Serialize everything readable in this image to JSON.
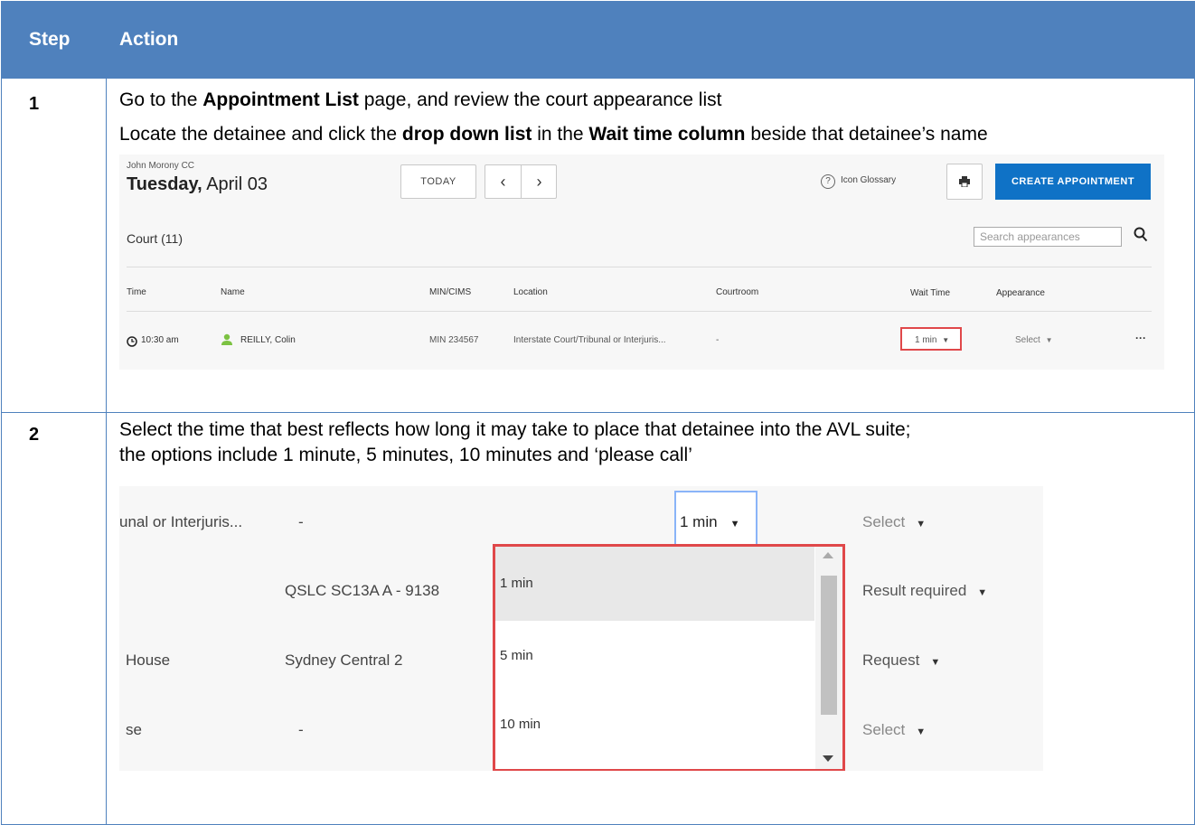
{
  "table": {
    "header_step": "Step",
    "header_action": "Action"
  },
  "step1": {
    "number": "1",
    "line1_pre": "Go to the ",
    "line1_bold": "Appointment List",
    "line1_post": " page, and review the court appearance list",
    "line2_pre": "Locate the detainee and click the ",
    "line2_bold1": "drop down list",
    "line2_mid": " in the ",
    "line2_bold2": "Wait time column",
    "line2_post": " beside that detainee’s name"
  },
  "screenshot1": {
    "centre": "John Morony CC",
    "day": "Tuesday,",
    "date": "April 03",
    "today_button": "TODAY",
    "prev": "‹",
    "next": "›",
    "glossary_icon": "?",
    "glossary": "Icon Glossary",
    "print_icon": "print-icon",
    "create_button": "CREATE APPOINTMENT",
    "court_heading": "Court (11)",
    "search_placeholder": "Search appearances",
    "columns": [
      "Time",
      "Name",
      "MIN/CIMS",
      "Location",
      "Courtroom",
      "Wait Time",
      "Appearance"
    ],
    "row": {
      "time": "10:30 am",
      "name": "REILLY, Colin",
      "min": "MIN 234567",
      "location": "Interstate Court/Tribunal or Interjuris...",
      "courtroom": "-",
      "wait": "1 min",
      "appearance": "Select",
      "more": "···"
    },
    "colors": {
      "accent": "#0f72c6",
      "highlight": "#e0484a",
      "person": "#7cc242"
    }
  },
  "step2": {
    "number": "2",
    "line1": "Select the time that best reflects how long it may take to place that detainee into the AVL suite;",
    "line2": "the options include 1 minute, 5 minutes, 10 minutes and ‘please call’"
  },
  "screenshot2": {
    "row1": {
      "location": "unal or Interjuris...",
      "courtroom": "-",
      "wait": "1 min",
      "appearance": "Select"
    },
    "row2": {
      "courtroom": "QSLC SC13A A - 9138",
      "appearance": "Result required"
    },
    "row3": {
      "location": "House",
      "courtroom": "Sydney Central 2",
      "appearance": "Request"
    },
    "row4": {
      "location": "se",
      "courtroom": "-",
      "appearance": "Select"
    },
    "options": [
      "1 min",
      "5 min",
      "10 min"
    ],
    "colors": {
      "focus": "#8ab4f8",
      "highlight": "#e0484a",
      "selected_bg": "#e8e8e8"
    }
  }
}
